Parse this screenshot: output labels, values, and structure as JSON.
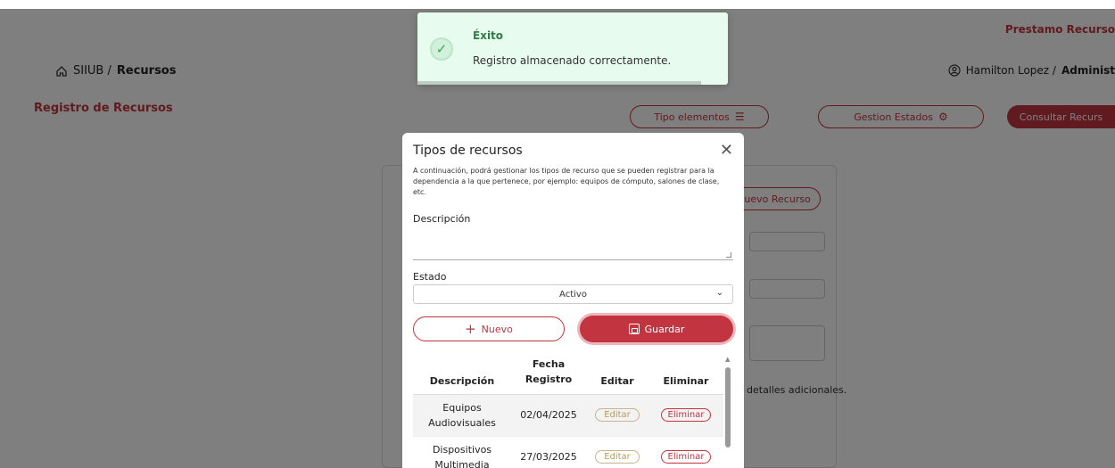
{
  "header": {
    "top_link": "Prestamo Recurso",
    "breadcrumb_root": "SIIUB /",
    "breadcrumb_current": "Recursos",
    "user_name": "Hamilton Lopez /",
    "user_role": "Administ"
  },
  "page": {
    "title": "Registro de Recursos",
    "btn_tipo_elementos": "Tipo elementos",
    "btn_gestion_estados": "Gestion Estados",
    "btn_consultar": "Consultar Recurs",
    "bg_nuevo_recurso": "Nuevo Recurso",
    "bg_detalles": "detalles adicionales."
  },
  "toast": {
    "title": "Éxito",
    "message": "Registro almacenado correctamente."
  },
  "modal": {
    "title": "Tipos de recursos",
    "close_glyph": "✕",
    "description": "A continuación, podrá gestionar los tipos de recurso que se pueden registrar para la dependencia a la que pertenece, por ejemplo: equipos de cómputo, salones de clase, etc.",
    "descripcion_label": "Descripción",
    "estado_label": "Estado",
    "estado_value": "Activo",
    "btn_nuevo": "Nuevo",
    "btn_guardar": "Guardar",
    "table": {
      "headers": [
        "Descripción",
        "Fecha Registro",
        "Editar",
        "Eliminar"
      ],
      "rows": [
        {
          "descripcion": "Equipos Audiovisuales",
          "fecha": "02/04/2025",
          "editar": "Editar",
          "eliminar": "Eliminar"
        },
        {
          "descripcion": "Dispositivos Multimedia",
          "fecha": "27/03/2025",
          "editar": "Editar",
          "eliminar": "Eliminar"
        }
      ]
    }
  },
  "colors": {
    "accent": "#c2343f",
    "toast_bg": "#e8fbef",
    "toast_title": "#2e7d46"
  }
}
